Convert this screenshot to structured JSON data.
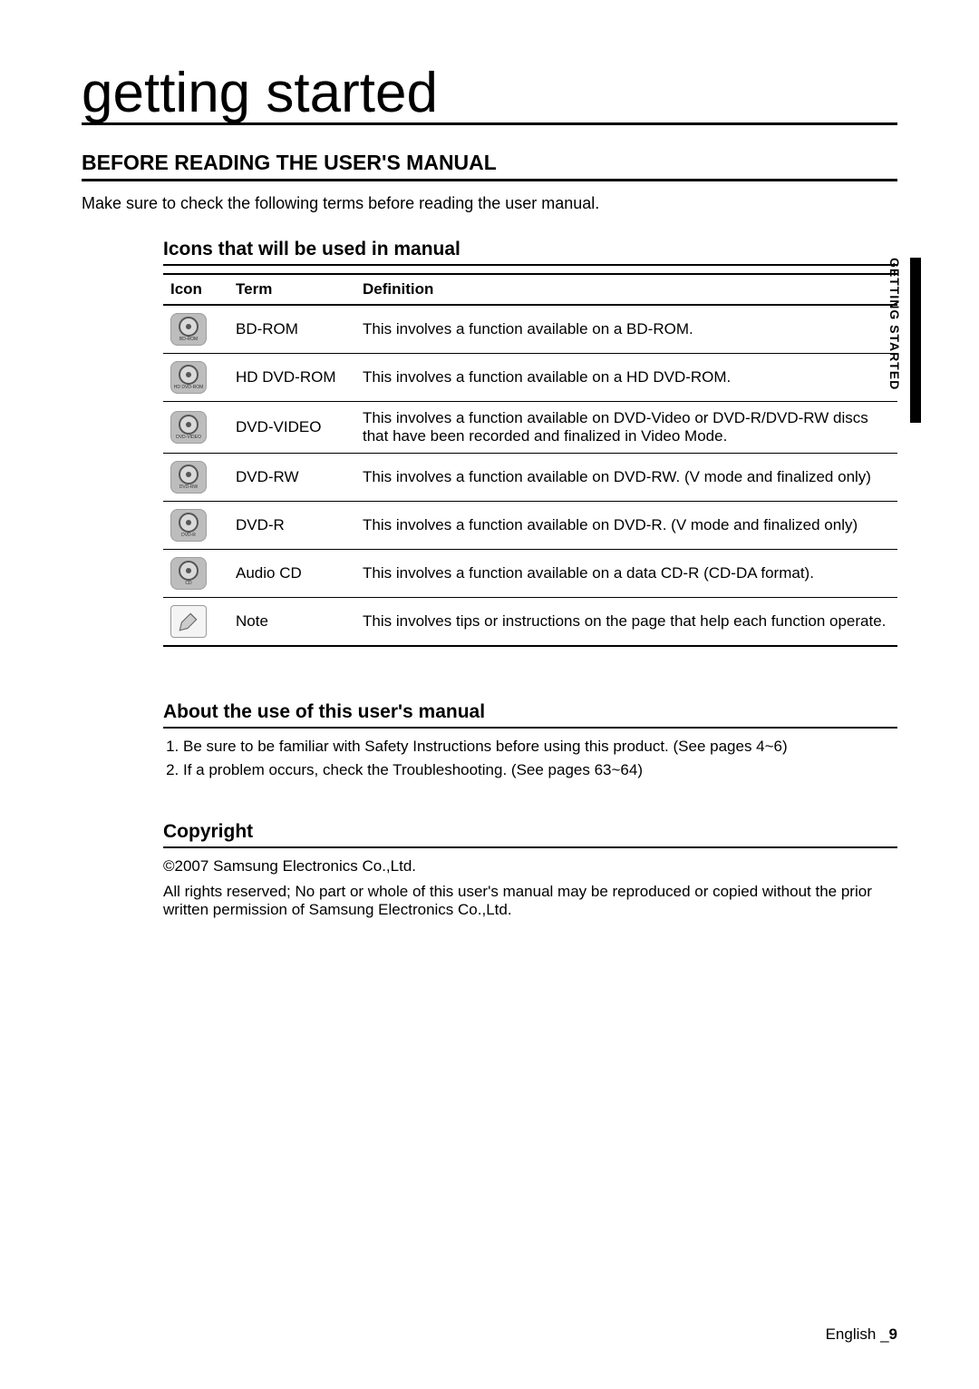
{
  "header": {
    "title": "getting started"
  },
  "section1": {
    "heading": "BEFORE READING THE USER'S MANUAL",
    "intro": "Make sure to check the following terms before reading the user manual."
  },
  "iconsTable": {
    "heading": "Icons that will be used in manual",
    "columns": {
      "c1": "Icon",
      "c2": "Term",
      "c3": "Definition"
    },
    "rows": [
      {
        "icon": "bdrom-icon",
        "label": "BD-ROM",
        "term": "BD-ROM",
        "def": "This involves a function available on a BD-ROM."
      },
      {
        "icon": "hddvdrom-icon",
        "label": "HD DVD-ROM",
        "term": "HD DVD-ROM",
        "def": "This involves a function available on a HD DVD-ROM."
      },
      {
        "icon": "dvdvideo-icon",
        "label": "DVD-VIDEO",
        "term": "DVD-VIDEO",
        "def": "This involves a function available on DVD-Video or DVD-R/DVD-RW discs that have been recorded and finalized in Video Mode."
      },
      {
        "icon": "dvdrw-icon",
        "label": "DVD-RW",
        "term": "DVD-RW",
        "def": "This involves a function available on DVD-RW. (V mode and finalized only)"
      },
      {
        "icon": "dvdr-icon",
        "label": "DVD-R",
        "term": "DVD-R",
        "def": "This involves a function available on DVD-R. (V mode and finalized only)"
      },
      {
        "icon": "cd-icon",
        "label": "CD",
        "term": "Audio CD",
        "def": "This involves a function available on a data CD-R (CD-DA format)."
      },
      {
        "icon": "note-icon",
        "label": "",
        "term": "Note",
        "def": "This involves tips or instructions on the page that help each function operate."
      }
    ]
  },
  "aboutUse": {
    "heading": "About the use of this user's manual",
    "items": [
      "Be sure to be familiar with Safety Instructions before using this product. (See pages 4~6)",
      "If a problem occurs, check the Troubleshooting. (See pages 63~64)"
    ]
  },
  "copyright": {
    "heading": "Copyright",
    "line1": "©2007 Samsung Electronics Co.,Ltd.",
    "line2": "All rights reserved; No part or whole of this user's manual may be reproduced or copied without the prior written permission of Samsung Electronics Co.,Ltd."
  },
  "sideLabel": "GETTING STARTED",
  "footer": {
    "lang": "English _",
    "page": "9"
  }
}
